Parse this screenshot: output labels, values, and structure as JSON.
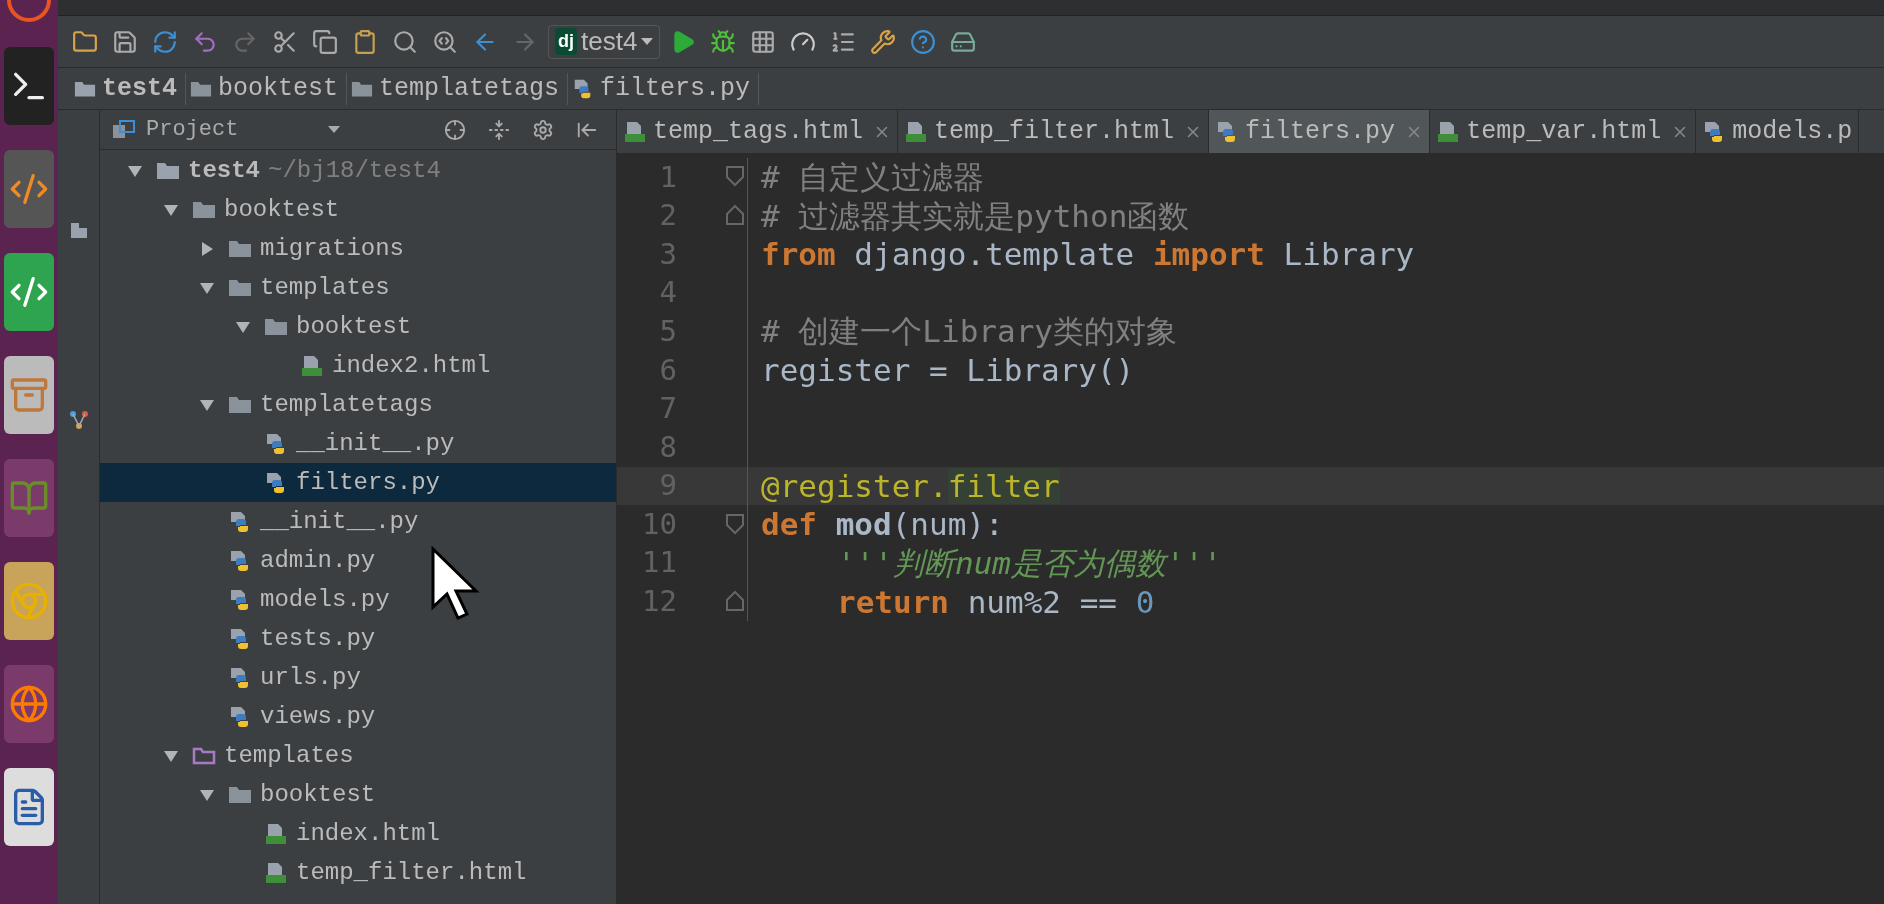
{
  "toolbar": {
    "run_config_badge": "dj",
    "run_config": "test4"
  },
  "breadcrumbs": [
    {
      "label": "test4",
      "kind": "folder",
      "bold": true
    },
    {
      "label": "booktest",
      "kind": "package",
      "bold": false
    },
    {
      "label": "templatetags",
      "kind": "package",
      "bold": false
    },
    {
      "label": "filters.py",
      "kind": "python",
      "bold": false
    }
  ],
  "project_panel": {
    "title": "Project",
    "tree": [
      {
        "name": "test4",
        "hint": "~/bj18/test4",
        "kind": "folder",
        "expanded": true,
        "selected": false,
        "children": [
          {
            "name": "booktest",
            "kind": "package",
            "expanded": true,
            "selected": false,
            "children": [
              {
                "name": "migrations",
                "kind": "package",
                "expanded": false,
                "selected": false
              },
              {
                "name": "templates",
                "kind": "package",
                "expanded": true,
                "selected": false,
                "children": [
                  {
                    "name": "booktest",
                    "kind": "package",
                    "expanded": true,
                    "selected": false,
                    "children": [
                      {
                        "name": "index2.html",
                        "kind": "html",
                        "selected": false
                      }
                    ]
                  }
                ]
              },
              {
                "name": "templatetags",
                "kind": "package",
                "expanded": true,
                "selected": false,
                "children": [
                  {
                    "name": "__init__.py",
                    "kind": "python",
                    "selected": false
                  },
                  {
                    "name": "filters.py",
                    "kind": "python",
                    "selected": true
                  }
                ]
              },
              {
                "name": "__init__.py",
                "kind": "python",
                "selected": false
              },
              {
                "name": "admin.py",
                "kind": "python",
                "selected": false
              },
              {
                "name": "models.py",
                "kind": "python",
                "selected": false
              },
              {
                "name": "tests.py",
                "kind": "python",
                "selected": false
              },
              {
                "name": "urls.py",
                "kind": "python",
                "selected": false
              },
              {
                "name": "views.py",
                "kind": "python",
                "selected": false
              }
            ]
          },
          {
            "name": "templates",
            "kind": "templates_folder",
            "expanded": true,
            "selected": false,
            "children": [
              {
                "name": "booktest",
                "kind": "package",
                "expanded": true,
                "selected": false,
                "children": [
                  {
                    "name": "index.html",
                    "kind": "html",
                    "selected": false
                  },
                  {
                    "name": "temp_filter.html",
                    "kind": "html",
                    "selected": false
                  }
                ]
              }
            ]
          }
        ]
      }
    ]
  },
  "editor": {
    "tabs": [
      {
        "label": "temp_tags.html",
        "kind": "html",
        "selected": false,
        "closable": true
      },
      {
        "label": "temp_filter.html",
        "kind": "html",
        "selected": false,
        "closable": true
      },
      {
        "label": "filters.py",
        "kind": "python",
        "selected": true,
        "closable": true
      },
      {
        "label": "temp_var.html",
        "kind": "html",
        "selected": false,
        "closable": true
      },
      {
        "label": "models.p",
        "kind": "python",
        "selected": false,
        "closable": false
      }
    ],
    "lines": [
      {
        "number": "1",
        "current": false,
        "fold_start": true,
        "fold_end": false,
        "indented": false,
        "tokens": [
          {
            "kind": "comment",
            "text": "# 自定义过滤器"
          }
        ]
      },
      {
        "number": "2",
        "current": false,
        "fold_start": false,
        "fold_end": true,
        "indented": false,
        "tokens": [
          {
            "kind": "comment",
            "text": "# 过滤器其实就是python函数"
          }
        ]
      },
      {
        "number": "3",
        "current": false,
        "fold_start": false,
        "fold_end": false,
        "indented": false,
        "tokens": [
          {
            "kind": "keyword",
            "text": "from"
          },
          {
            "kind": "plain",
            "text": " django.template "
          },
          {
            "kind": "keyword",
            "text": "import"
          },
          {
            "kind": "plain",
            "text": " Library"
          }
        ]
      },
      {
        "number": "4",
        "current": false,
        "fold_start": false,
        "fold_end": false
      },
      {
        "number": "5",
        "current": false,
        "fold_start": false,
        "fold_end": false,
        "indented": false,
        "tokens": [
          {
            "kind": "comment",
            "text": "# 创建一个Library类的对象"
          }
        ]
      },
      {
        "number": "6",
        "current": false,
        "fold_start": false,
        "fold_end": false,
        "indented": false,
        "tokens": [
          {
            "kind": "plain",
            "text": "register = Library()"
          }
        ]
      },
      {
        "number": "7",
        "current": false,
        "fold_start": false,
        "fold_end": false
      },
      {
        "number": "8",
        "current": false,
        "fold_start": false,
        "fold_end": false
      },
      {
        "number": "9",
        "current": true,
        "fold_start": false,
        "fold_end": false,
        "indented": false,
        "tokens": [
          {
            "kind": "decorator",
            "text": "@register."
          },
          {
            "kind": "decorator_match",
            "text": "filter"
          }
        ]
      },
      {
        "number": "10",
        "current": false,
        "fold_start": true,
        "fold_end": false,
        "indented": false,
        "tokens": [
          {
            "kind": "keyword",
            "text": "def"
          },
          {
            "kind": "function",
            "text": " mod"
          },
          {
            "kind": "plain",
            "text": "(num):"
          }
        ]
      },
      {
        "number": "11",
        "current": false,
        "fold_start": false,
        "fold_end": false,
        "indented": true,
        "tokens": [
          {
            "kind": "docstring",
            "text": "'''判断num是否为偶数'''"
          }
        ]
      },
      {
        "number": "12",
        "current": false,
        "fold_start": false,
        "fold_end": true,
        "indented": true,
        "tokens": [
          {
            "kind": "keyword",
            "text": "return"
          },
          {
            "kind": "plain",
            "text": " num%2 == "
          },
          {
            "kind": "number",
            "text": "0"
          }
        ]
      }
    ]
  }
}
